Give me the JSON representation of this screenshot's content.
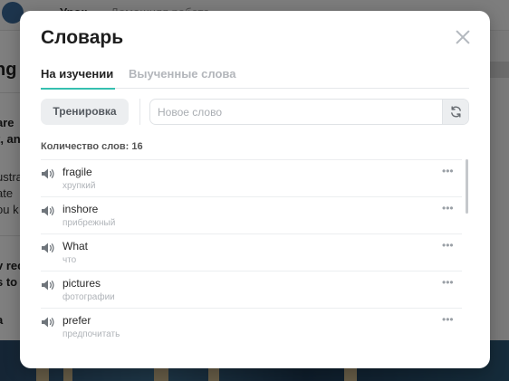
{
  "background": {
    "tab_lesson": "Урок",
    "tab_homework": "Домашняя работа",
    "heading_fragment": "ng",
    "lines": [
      "are",
      "t, an",
      "ustra",
      "ate",
      "ou k",
      "v rec",
      "s to",
      "a"
    ]
  },
  "dictionary": {
    "title": "Словарь",
    "tabs": [
      {
        "label": "На изучении",
        "active": true
      },
      {
        "label": "Выученные слова",
        "active": false
      }
    ],
    "train_button": "Тренировка",
    "new_word_placeholder": "Новое слово",
    "word_count_label": "Количество слов:",
    "word_count": "16",
    "words": [
      {
        "word": "fragile",
        "translation": "хрупкий"
      },
      {
        "word": "inshore",
        "translation": "прибрежный"
      },
      {
        "word": "What",
        "translation": "что"
      },
      {
        "word": "pictures",
        "translation": "фотографии"
      },
      {
        "word": "prefer",
        "translation": "предпочитать"
      }
    ],
    "more_glyph": "•••",
    "icons": {
      "close": "close-icon",
      "refresh": "refresh-icon",
      "speaker": "speaker-icon",
      "more": "more-dots-icon"
    },
    "colors": {
      "accent": "#36c0b0",
      "overlay": "rgba(0,0,0,0.5)"
    }
  }
}
